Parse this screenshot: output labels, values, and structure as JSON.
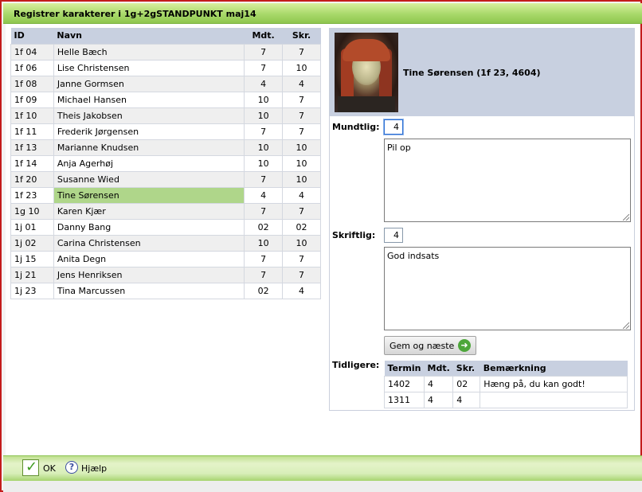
{
  "window": {
    "title": "Registrer karakterer i 1g+2gSTANDPUNKT maj14"
  },
  "grades_table": {
    "headers": {
      "id": "ID",
      "name": "Navn",
      "mdt": "Mdt.",
      "skr": "Skr."
    },
    "rows": [
      {
        "id": "1f 04",
        "name": "Helle Bæch",
        "mdt": "7",
        "skr": "7"
      },
      {
        "id": "1f 06",
        "name": "Lise Christensen",
        "mdt": "7",
        "skr": "10"
      },
      {
        "id": "1f 08",
        "name": "Janne Gormsen",
        "mdt": "4",
        "skr": "4"
      },
      {
        "id": "1f 09",
        "name": "Michael Hansen",
        "mdt": "10",
        "skr": "7"
      },
      {
        "id": "1f 10",
        "name": "Theis Jakobsen",
        "mdt": "10",
        "skr": "7"
      },
      {
        "id": "1f 11",
        "name": "Frederik Jørgensen",
        "mdt": "7",
        "skr": "7"
      },
      {
        "id": "1f 13",
        "name": "Marianne Knudsen",
        "mdt": "10",
        "skr": "10"
      },
      {
        "id": "1f 14",
        "name": "Anja Agerhøj",
        "mdt": "10",
        "skr": "10"
      },
      {
        "id": "1f 20",
        "name": "Susanne Wied",
        "mdt": "7",
        "skr": "10"
      },
      {
        "id": "1f 23",
        "name": "Tine Sørensen",
        "mdt": "4",
        "skr": "4",
        "selected": true
      },
      {
        "id": "1g 10",
        "name": "Karen Kjær",
        "mdt": "7",
        "skr": "7"
      },
      {
        "id": "1j 01",
        "name": "Danny Bang",
        "mdt": "02",
        "skr": "02"
      },
      {
        "id": "1j 02",
        "name": "Carina Christensen",
        "mdt": "10",
        "skr": "10"
      },
      {
        "id": "1j 15",
        "name": "Anita Degn",
        "mdt": "7",
        "skr": "7"
      },
      {
        "id": "1j 21",
        "name": "Jens Henriksen",
        "mdt": "7",
        "skr": "7"
      },
      {
        "id": "1j 23",
        "name": "Tina Marcussen",
        "mdt": "02",
        "skr": "4"
      }
    ]
  },
  "student": {
    "heading": "Tine Sørensen (1f 23, 4604)",
    "oral_label": "Mundtlig:",
    "oral_grade": "4",
    "oral_comment": "Pil op",
    "written_label": "Skriftlig:",
    "written_grade": "4",
    "written_comment": "God indsats",
    "save_button": "Gem og næste",
    "history_label": "Tidligere:"
  },
  "history_table": {
    "headers": {
      "term": "Termin",
      "mdt": "Mdt.",
      "skr": "Skr.",
      "note": "Bemærkning"
    },
    "rows": [
      {
        "term": "1402",
        "mdt": "4",
        "skr": "02",
        "note": "Hæng på, du kan godt!"
      },
      {
        "term": "1311",
        "mdt": "4",
        "skr": "4",
        "note": ""
      }
    ]
  },
  "footer": {
    "ok_label": "OK",
    "help_label": "Hjælp"
  },
  "colors": {
    "frame_border": "#c41b1b",
    "header_green": "#a8d96a",
    "table_header": "#c8d0e0",
    "selected_row": "#afd68a"
  },
  "icons": {
    "ok": "checkmark-icon",
    "help": "help-icon",
    "next": "arrow-right-icon"
  }
}
